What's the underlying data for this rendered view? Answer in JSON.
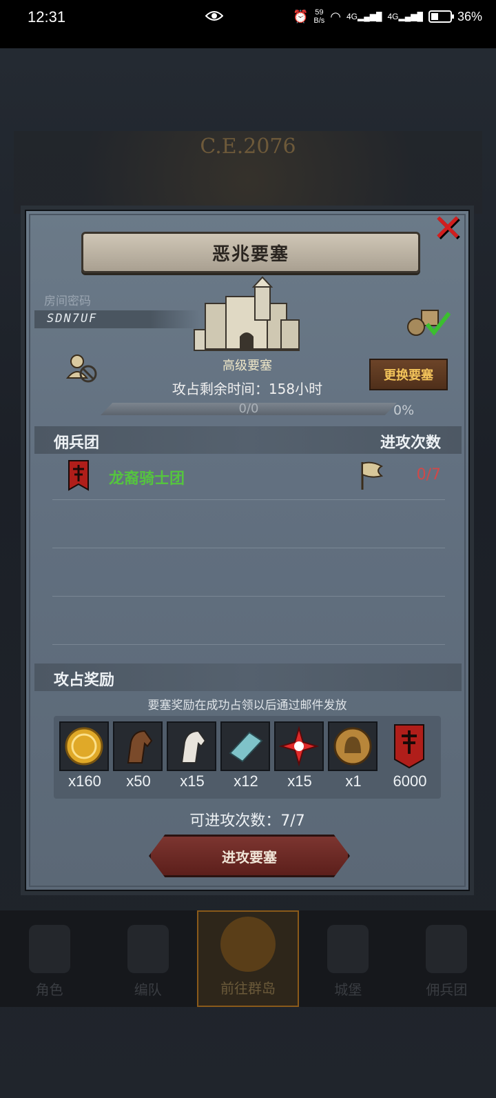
{
  "status_bar": {
    "time": "12:31",
    "net_speed_value": "59",
    "net_speed_unit": "B/s",
    "signal_1": "4G",
    "signal_2": "4G",
    "battery": "36%"
  },
  "background": {
    "era": "C.E.2076",
    "nav": [
      "角色",
      "编队",
      "前往群岛",
      "城堡",
      "佣兵团"
    ]
  },
  "modal": {
    "title": "恶兆要塞",
    "room_label": "房间密码",
    "room_code": "SDN7UF",
    "fortress_type": "高级要塞",
    "time_left": "攻占剩余时间：158小时",
    "change_button": "更换要塞",
    "progress_text": "0/0",
    "progress_pct": "0%",
    "progress_value": 0,
    "guild_header": "佣兵团",
    "attacks_header": "进攻次数",
    "guilds": [
      {
        "name": "龙裔骑士团",
        "attacks": "0/7"
      }
    ],
    "reward_header": "攻占奖励",
    "reward_hint": "要塞奖励在成功占领以后通过邮件发放",
    "rewards": [
      {
        "icon": "gold-coin-icon",
        "qty": "x160"
      },
      {
        "icon": "brown-horse-icon",
        "qty": "x50"
      },
      {
        "icon": "white-horse-icon",
        "qty": "x15"
      },
      {
        "icon": "cloth-roll-icon",
        "qty": "x12"
      },
      {
        "icon": "red-star-icon",
        "qty": "x15"
      },
      {
        "icon": "knight-medal-icon",
        "qty": "x1"
      },
      {
        "icon": "guild-banner-icon",
        "qty": "6000"
      }
    ],
    "remaining_attacks": "可进攻次数：7/7",
    "attack_button": "进攻要塞"
  },
  "colors": {
    "guild_name": "#55c43f",
    "attack_count": "#d14848",
    "change_btn_text": "#f3c35a",
    "close": "#d21e1e"
  }
}
